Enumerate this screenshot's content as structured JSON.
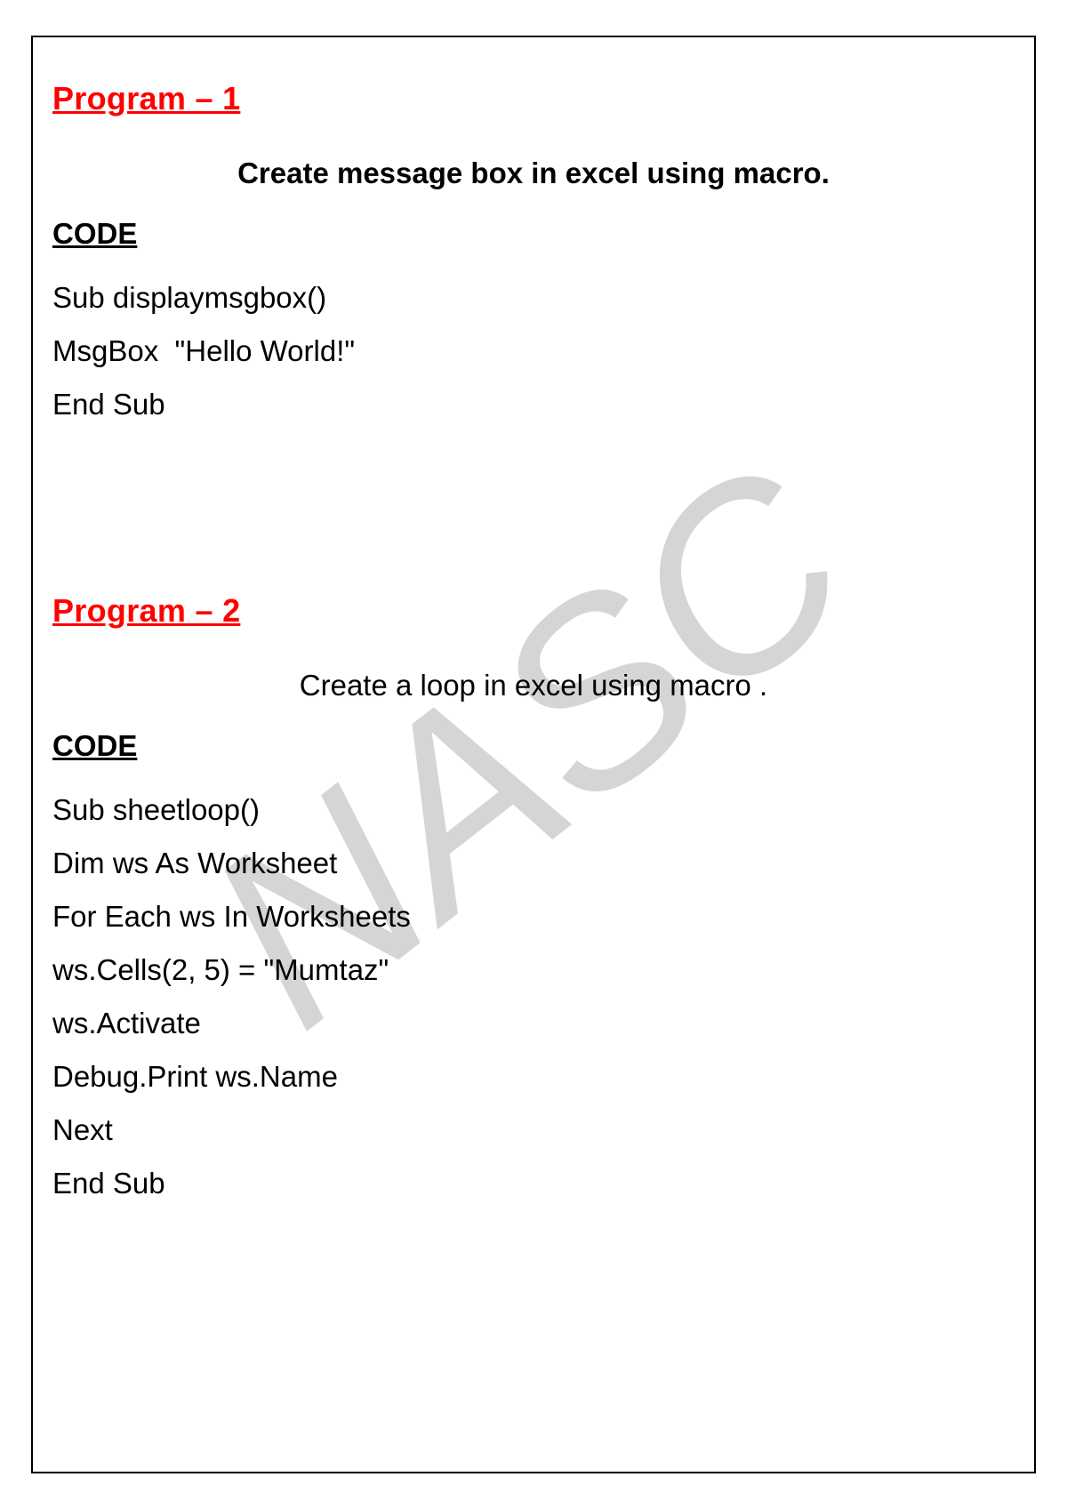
{
  "watermark_text": "NASC",
  "program1": {
    "heading": "Program – 1",
    "subtitle": "Create message box in excel using macro.",
    "code_label": "CODE",
    "code_lines": [
      "Sub displaymsgbox()",
      "MsgBox  \"Hello World!\"",
      "End Sub"
    ]
  },
  "program2": {
    "heading": "Program – 2",
    "subtitle": "Create a loop in excel using macro .",
    "code_label": "CODE",
    "code_lines": [
      "Sub sheetloop()",
      "Dim ws As Worksheet",
      "For Each ws In Worksheets",
      "ws.Cells(2, 5) = \"Mumtaz\"",
      "ws.Activate",
      "Debug.Print ws.Name",
      "Next",
      "End Sub"
    ]
  }
}
